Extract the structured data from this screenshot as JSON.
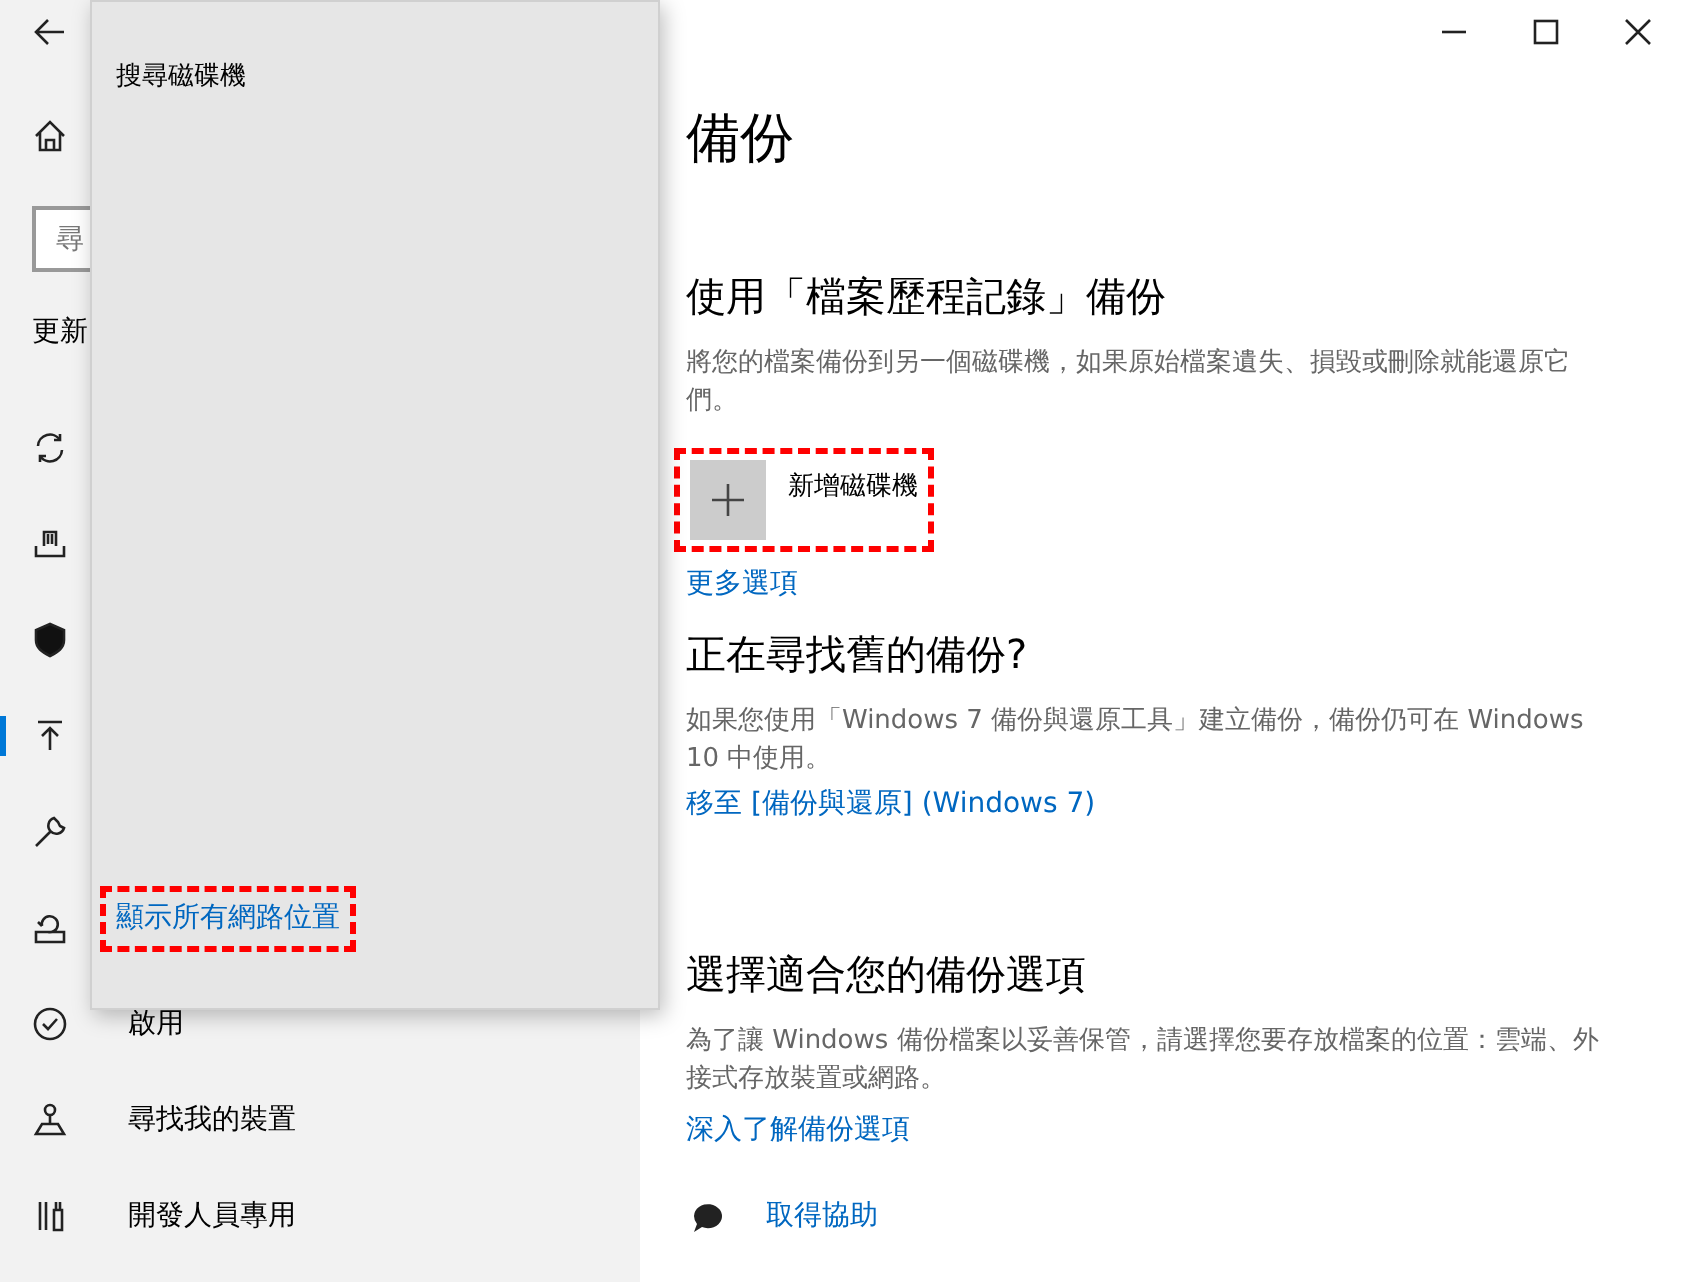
{
  "sidebar": {
    "search": {
      "placeholder": "尋"
    },
    "heading": "更新",
    "items": [
      {
        "selected": false
      },
      {
        "selected": false
      },
      {
        "selected": false
      },
      {
        "selected": true
      },
      {
        "selected": false
      },
      {
        "selected": false
      },
      {
        "label": "啟用",
        "selected": false
      },
      {
        "label": "尋找我的裝置",
        "selected": false
      },
      {
        "label": "開發人員專用",
        "selected": false
      }
    ]
  },
  "flyout": {
    "title": "搜尋磁碟機",
    "link": {
      "text": "顯示所有網路位置",
      "highlighted": true
    }
  },
  "page": {
    "title": "備份",
    "sections": [
      {
        "heading": "使用「檔案歷程記錄」備份",
        "description": "將您的檔案備份到另一個磁碟機，如果原始檔案遺失、損毀或刪除就能還原它們。",
        "add_button": {
          "label": "新增磁碟機",
          "highlighted": true
        },
        "link": "更多選項"
      },
      {
        "heading": "正在尋找舊的備份?",
        "description": "如果您使用「Windows 7 備份與還原工具」建立備份，備份仍可在 Windows 10 中使用。",
        "link": "移至 [備份與還原] (Windows 7)"
      },
      {
        "heading": "選擇適合您的備份選項",
        "description": "為了讓 Windows 備份檔案以妥善保管，請選擇您要存放檔案的位置：雲端、外接式存放裝置或網路。",
        "link": "深入了解備份選項"
      }
    ],
    "help_link": "取得協助"
  }
}
